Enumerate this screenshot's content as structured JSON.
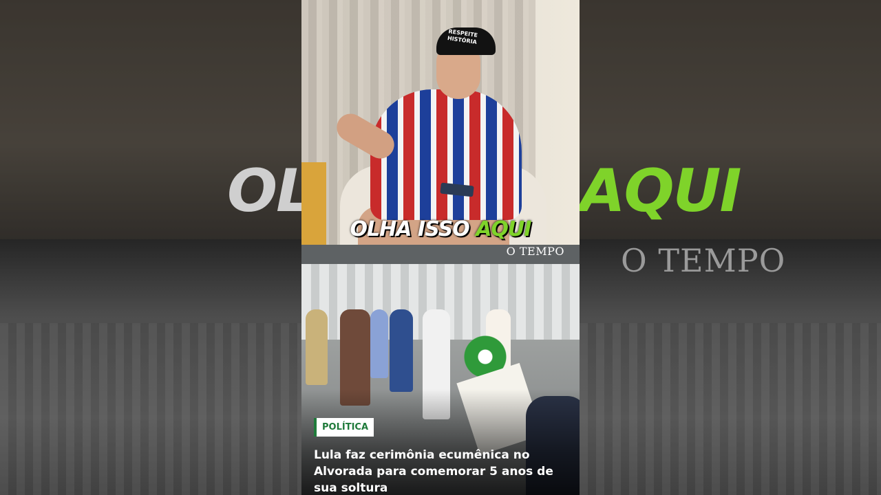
{
  "video": {
    "caption_word1": "OLHA ISSO",
    "caption_word2": "AQUI",
    "cap_text": "RESPEITE\nHISTÓRIA",
    "side_left_word": "OL",
    "side_right_word": "AQUI"
  },
  "news_card": {
    "brand": "O TEMPO",
    "category": "POLÍTICA",
    "headline": "Lula faz cerimônia ecumênica no Alvorada para comemorar 5 anos de sua soltura"
  },
  "colors": {
    "accent_green": "#7fd32a",
    "badge_green": "#1f7a3a"
  }
}
